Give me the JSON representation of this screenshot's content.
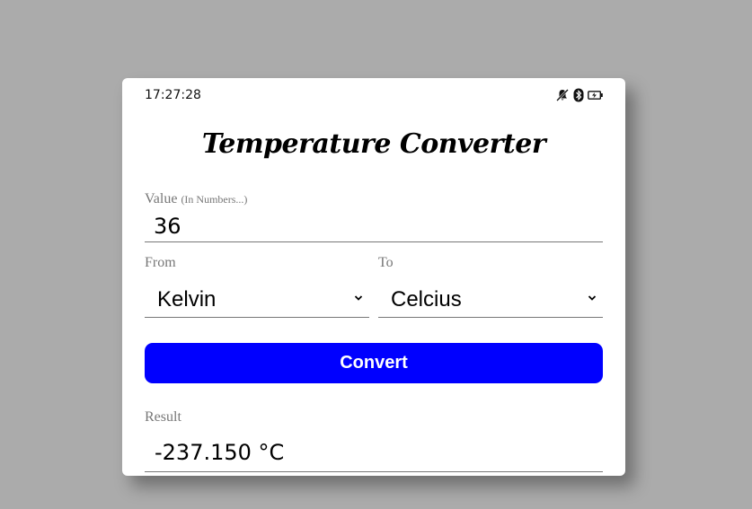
{
  "status_bar": {
    "time": "17:27:28",
    "icons": [
      "bell-muted-icon",
      "bluetooth-icon",
      "battery-charging-icon"
    ]
  },
  "app": {
    "title": "Temperature Converter"
  },
  "value_field": {
    "label": "Value",
    "hint": "(In Numbers...)",
    "value": "36"
  },
  "from_field": {
    "label": "From",
    "selected": "Kelvin"
  },
  "to_field": {
    "label": "To",
    "selected": "Celcius"
  },
  "convert_button": {
    "label": "Convert",
    "color": "#0000ff"
  },
  "result_field": {
    "label": "Result",
    "value": "-237.150 °C"
  }
}
